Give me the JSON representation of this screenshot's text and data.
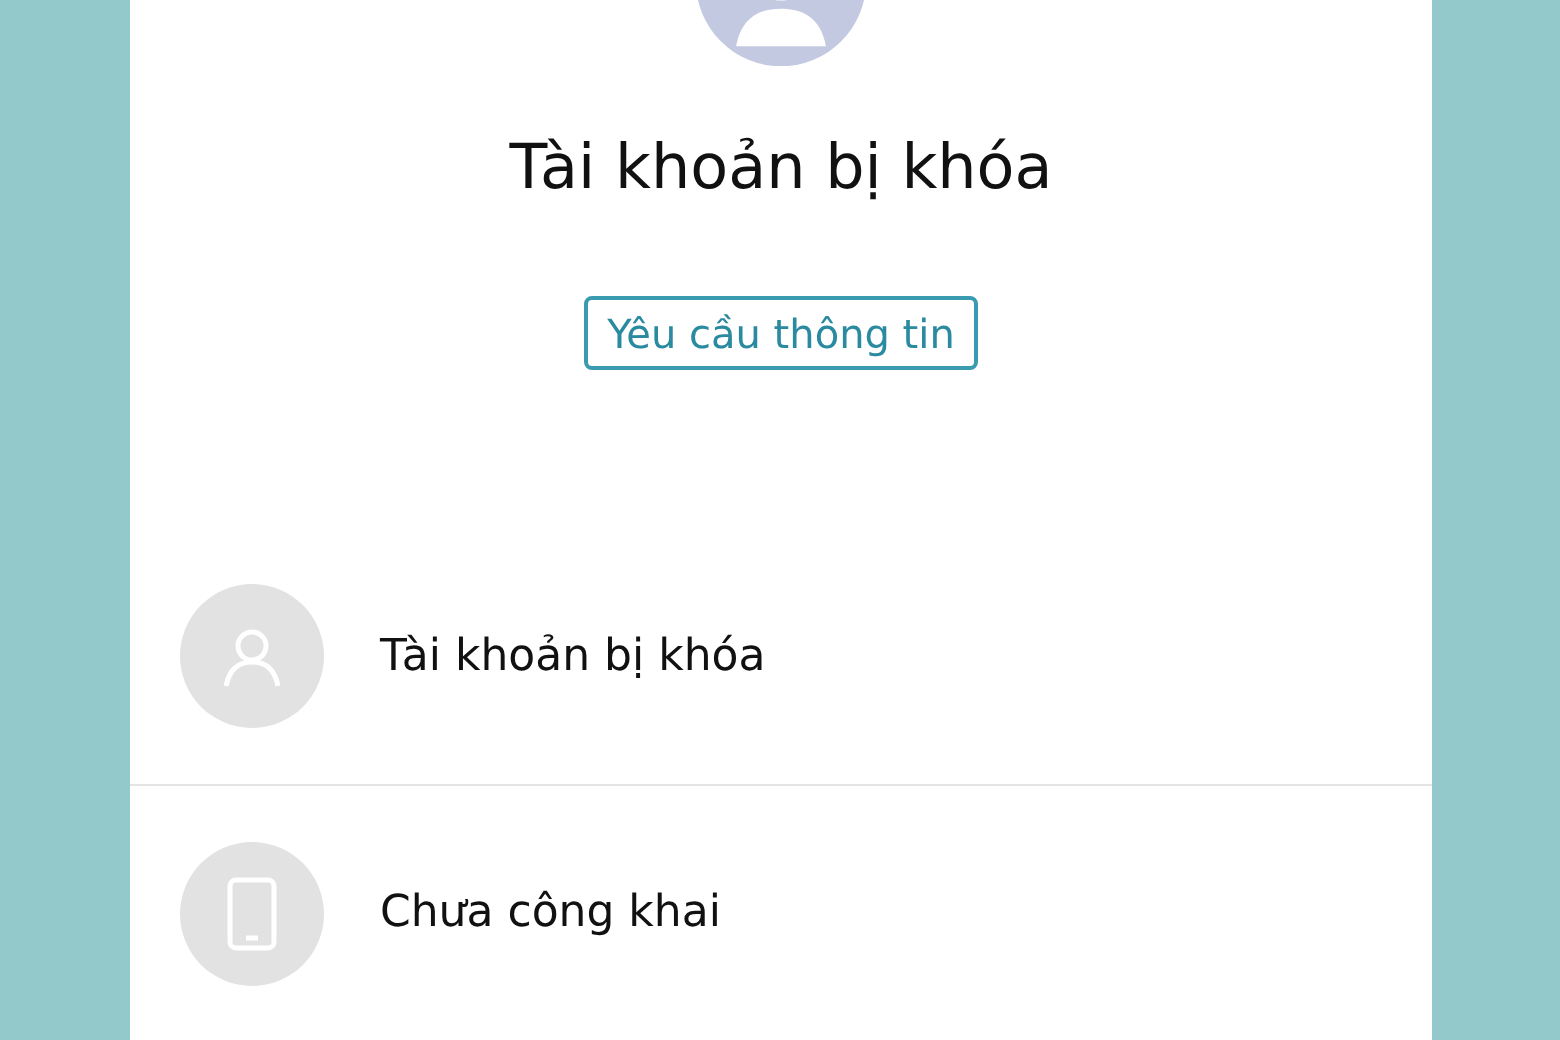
{
  "profile": {
    "title": "Tài khoản bị khóa",
    "request_button": "Yêu cầu thông tin"
  },
  "items": [
    {
      "kind": "person",
      "label": "Tài khoản bị khóa"
    },
    {
      "kind": "phone",
      "label": "Chưa công khai"
    }
  ]
}
